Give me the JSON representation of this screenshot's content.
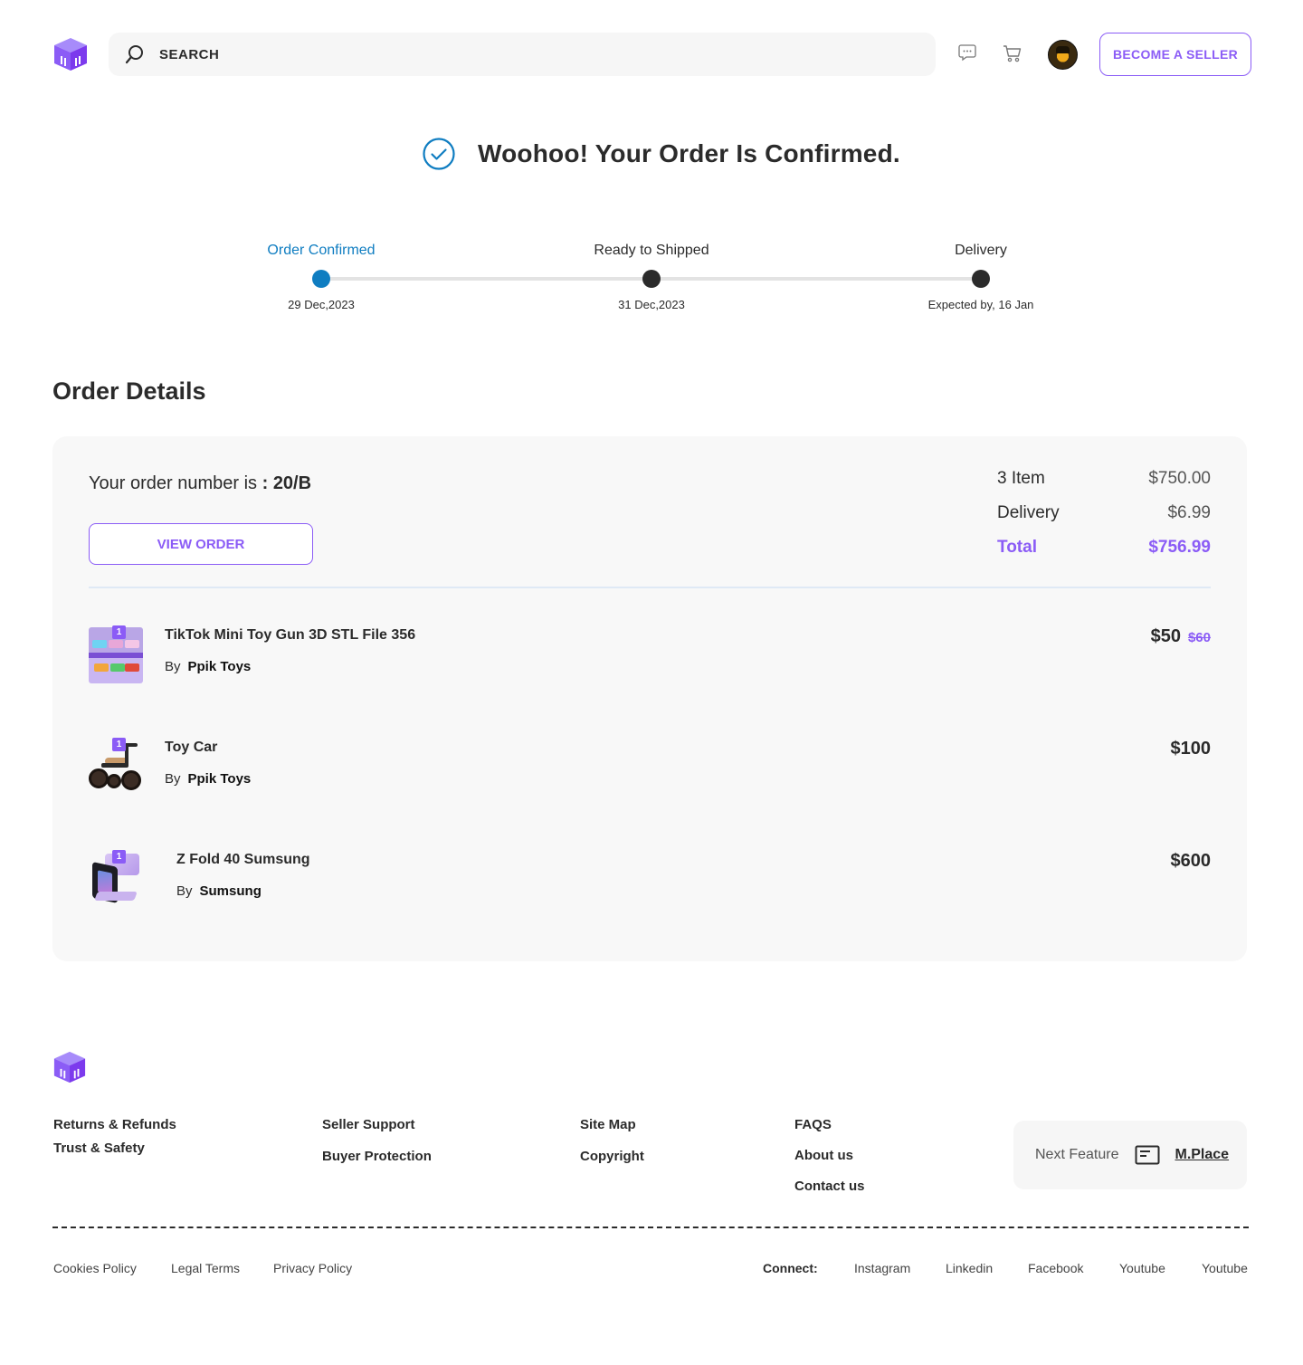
{
  "header": {
    "search_placeholder": "SEARCH",
    "seller_button": "BECOME A SELLER"
  },
  "confirmation": {
    "title": "Woohoo! Your Order Is Confirmed."
  },
  "progress": {
    "steps": [
      {
        "label": "Order Confirmed",
        "date": "29 Dec,2023",
        "active": true
      },
      {
        "label": "Ready to Shipped",
        "date": "31 Dec,2023",
        "active": false
      },
      {
        "label": "Delivery",
        "date": "Expected by, 16 Jan",
        "active": false
      }
    ]
  },
  "order": {
    "section_title": "Order Details",
    "number_prefix": "Your order number is",
    "number_sep": " : ",
    "number": "20/B",
    "view_button": "VIEW ORDER",
    "summary": [
      {
        "label": "3 Item",
        "amount": "$750.00"
      },
      {
        "label": "Delivery",
        "amount": "$6.99"
      },
      {
        "label": "Total",
        "amount": "$756.99"
      }
    ],
    "items": [
      {
        "name": "TikTok Mini Toy Gun 3D STL File 356",
        "by_label": "By",
        "seller": "Ppik Toys",
        "qty": "1",
        "price": "$50",
        "old_price": "$60"
      },
      {
        "name": "Toy Car",
        "by_label": "By",
        "seller": "Ppik Toys",
        "qty": "1",
        "price": "$100"
      },
      {
        "name": "Z Fold 40 Sumsung",
        "by_label": "By",
        "seller": "Sumsung",
        "qty": "1",
        "price": "$600"
      }
    ]
  },
  "footer": {
    "col1": [
      "Returns & Refunds",
      "Trust & Safety"
    ],
    "col2": [
      "Seller Support",
      "Buyer Protection"
    ],
    "col3": [
      "Site Map",
      "Copyright"
    ],
    "col4": [
      "FAQS",
      "About us",
      "Contact us"
    ],
    "next_feature_label": "Next Feature",
    "next_feature_link": "M.Place",
    "legal": [
      "Cookies Policy",
      "Legal Terms",
      "Privacy Policy"
    ],
    "connect_label": "Connect:",
    "social": [
      "Instagram",
      "Linkedin",
      "Facebook",
      "Youtube",
      "Youtube"
    ]
  },
  "colors": {
    "accent": "#8b5cf6",
    "progress_active": "#0f7dc1",
    "text": "#2b2b2b"
  }
}
